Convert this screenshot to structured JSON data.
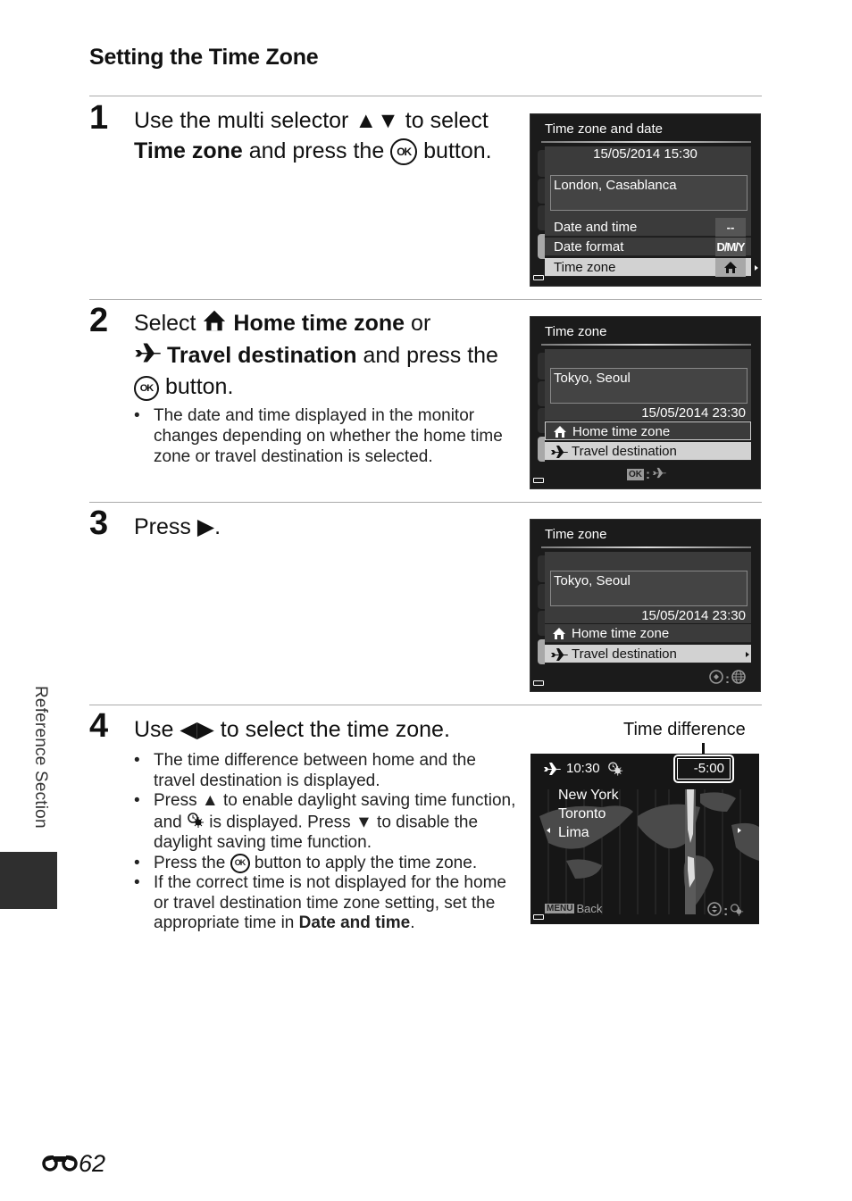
{
  "page": {
    "title": "Setting the Time Zone",
    "section_label": "Reference Section",
    "page_number": "62",
    "page_number_icon": "binoculars-icon"
  },
  "steps": [
    {
      "number": "1",
      "text_parts": [
        "Use the multi selector ",
        "▲▼",
        " to select ",
        "Time zone",
        " and press the ",
        "OK",
        " button."
      ],
      "bullets": []
    },
    {
      "number": "2",
      "text_parts": [
        "Select ",
        "Home time zone",
        " or ",
        "Travel destination",
        " and press the ",
        "OK",
        " button."
      ],
      "bullets": [
        "The date and time displayed in the monitor changes depending on whether the home time zone or travel destination is selected."
      ]
    },
    {
      "number": "3",
      "text_parts": [
        "Press ",
        "▶",
        "."
      ],
      "bullets": []
    },
    {
      "number": "4",
      "text_parts": [
        "Use ",
        "◀▶",
        " to select the time zone."
      ],
      "bullets": [
        "The time difference between home and the travel destination is displayed.",
        [
          "Press ",
          "▲",
          " to enable daylight saving time function, and ",
          " is displayed. Press ",
          "▼",
          " to disable the daylight saving time function."
        ],
        [
          "Press the ",
          " button to apply the time zone."
        ],
        [
          "If the correct time is not displayed for the home or travel destination time zone setting, set the appropriate time in ",
          "Date and time",
          "."
        ]
      ]
    }
  ],
  "screens": {
    "screen1": {
      "title": "Time zone and date",
      "datetime": "15/05/2014  15:30",
      "city": "London, Casablanca",
      "menu": [
        {
          "label": "Date and time",
          "value": "--"
        },
        {
          "label": "Date format",
          "value": "D/M/Y"
        },
        {
          "label": "Time zone",
          "value": "home-icon",
          "selected": true
        }
      ]
    },
    "screen2": {
      "title": "Time zone",
      "city": "Tokyo, Seoul",
      "datetime": "15/05/2014  23:30",
      "options": [
        "Home time zone",
        "Travel destination"
      ],
      "selected": "Travel destination",
      "footer_hint": "OK: travel"
    },
    "screen3": {
      "title": "Time zone",
      "city": "Tokyo, Seoul",
      "datetime": "15/05/2014  23:30",
      "options": [
        "Home time zone",
        "Travel destination"
      ],
      "selected": "Travel destination",
      "footer_hint": "selector: globe"
    },
    "screen4": {
      "time": "10:30",
      "time_difference": "-5:00",
      "cities": [
        "New York",
        "Toronto",
        "Lima"
      ],
      "back_label": "Back",
      "menu_key": "MENU",
      "callout": "Time difference"
    }
  }
}
